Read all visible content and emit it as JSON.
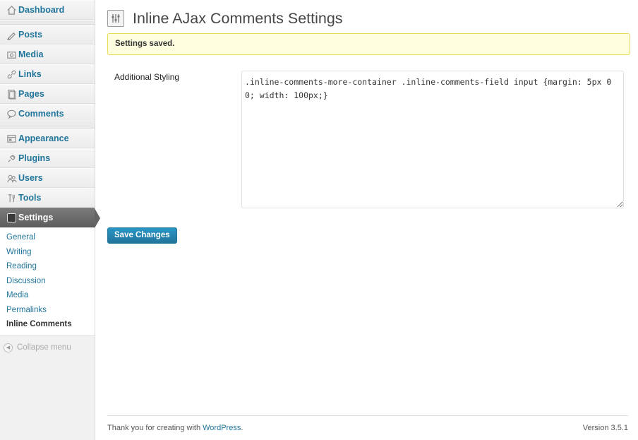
{
  "sidebar": {
    "items": [
      {
        "label": "Dashboard",
        "icon": "dashboard-icon"
      },
      {
        "label": "Posts",
        "icon": "posts-icon"
      },
      {
        "label": "Media",
        "icon": "media-icon"
      },
      {
        "label": "Links",
        "icon": "links-icon"
      },
      {
        "label": "Pages",
        "icon": "pages-icon"
      },
      {
        "label": "Comments",
        "icon": "comments-icon"
      },
      {
        "label": "Appearance",
        "icon": "appearance-icon"
      },
      {
        "label": "Plugins",
        "icon": "plugins-icon"
      },
      {
        "label": "Users",
        "icon": "users-icon"
      },
      {
        "label": "Tools",
        "icon": "tools-icon"
      },
      {
        "label": "Settings",
        "icon": "settings-icon"
      }
    ],
    "submenu": [
      "General",
      "Writing",
      "Reading",
      "Discussion",
      "Media",
      "Permalinks",
      "Inline Comments"
    ],
    "collapse_label": "Collapse menu"
  },
  "page": {
    "title": "Inline AJax Comments Settings",
    "notice": "Settings saved.",
    "field_label": "Additional Styling",
    "field_value": ".inline-comments-more-container .inline-comments-field input {margin: 5px 0 0; width: 100px;}",
    "save_label": "Save Changes"
  },
  "footer": {
    "thanks_prefix": "Thank you for creating with ",
    "thanks_link": "WordPress",
    "thanks_suffix": ".",
    "version": "Version 3.5.1"
  },
  "colors": {
    "link": "#21759b",
    "notice_bg": "#ffffe0",
    "notice_border": "#e6db55",
    "button": "#21759b"
  }
}
